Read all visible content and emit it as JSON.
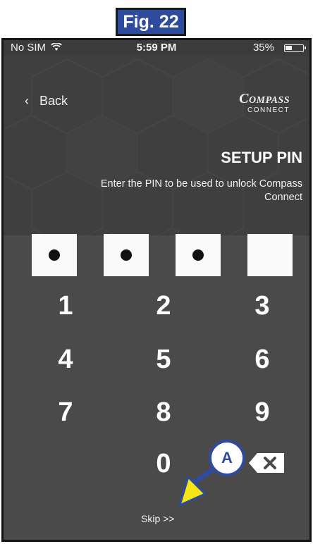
{
  "figure": {
    "label": "Fig. 22"
  },
  "status_bar": {
    "carrier": "No SIM",
    "wifi_icon": "wifi-icon",
    "time": "5:59 PM",
    "battery_percent": "35%",
    "battery_level": 0.35
  },
  "header": {
    "back_label": "Back",
    "logo_line1": "OMPASS",
    "logo_line1_initial": "C",
    "logo_line2": "ONNECT",
    "logo_line2_initial": "C",
    "title": "SETUP PIN",
    "subtitle": "Enter the PIN to be used to unlock Compass Connect"
  },
  "pin": {
    "length": 4,
    "filled": 3
  },
  "keypad": {
    "keys": [
      "1",
      "2",
      "3",
      "4",
      "5",
      "6",
      "7",
      "8",
      "9",
      "0"
    ],
    "backspace_icon": "backspace-icon"
  },
  "skip_label": "Skip >>",
  "annotation": {
    "callout_label": "A",
    "arrow_color": "#f5e614",
    "callout_color": "#2f4b9d"
  }
}
